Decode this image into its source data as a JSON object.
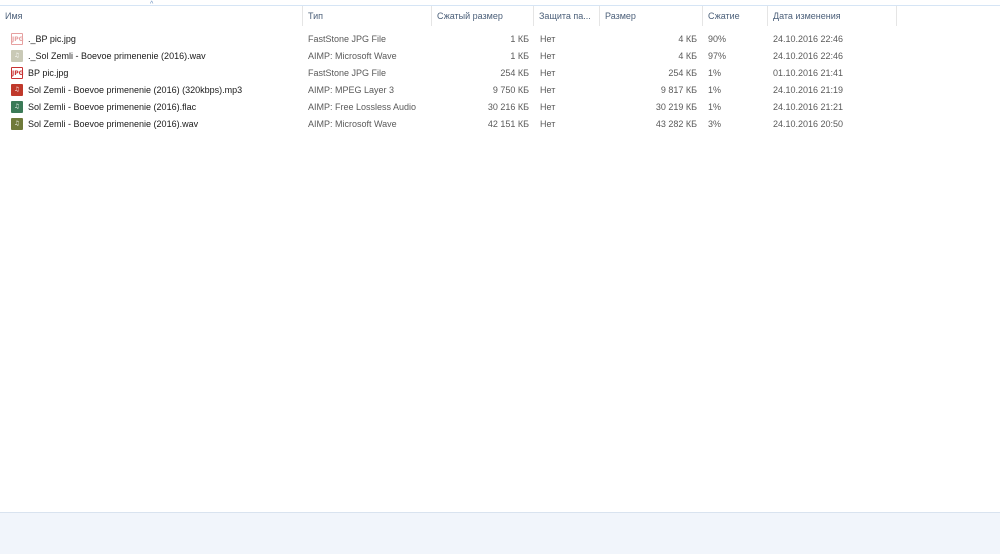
{
  "columns": {
    "name": "Имя",
    "type": "Тип",
    "compressed_size": "Сжатый размер",
    "protection": "Защита па...",
    "size": "Размер",
    "ratio": "Сжатие",
    "modified": "Дата изменения"
  },
  "sort": {
    "column": "name",
    "arrow": "^"
  },
  "files": [
    {
      "icon": "jpg-file-icon",
      "name": "._BP pic.jpg",
      "type": "FastStone JPG File",
      "compressed_size": "1 КБ",
      "protection": "Нет",
      "size": "4 КБ",
      "ratio": "90%",
      "modified": "24.10.2016 22:46"
    },
    {
      "icon": "wav-file-icon",
      "name": "._Sol Zemli - Boevoe primenenie (2016).wav",
      "type": "AIMP: Microsoft Wave",
      "compressed_size": "1 КБ",
      "protection": "Нет",
      "size": "4 КБ",
      "ratio": "97%",
      "modified": "24.10.2016 22:46"
    },
    {
      "icon": "jpg-file-icon",
      "name": "BP pic.jpg",
      "type": "FastStone JPG File",
      "compressed_size": "254 КБ",
      "protection": "Нет",
      "size": "254 КБ",
      "ratio": "1%",
      "modified": "01.10.2016 21:41"
    },
    {
      "icon": "mp3-file-icon",
      "name": "Sol Zemli - Boevoe primenenie (2016) (320kbps).mp3",
      "type": "AIMP: MPEG Layer 3",
      "compressed_size": "9 750 КБ",
      "protection": "Нет",
      "size": "9 817 КБ",
      "ratio": "1%",
      "modified": "24.10.2016 21:19"
    },
    {
      "icon": "flac-file-icon",
      "name": "Sol Zemli - Boevoe primenenie (2016).flac",
      "type": "AIMP: Free Lossless Audio",
      "compressed_size": "30 216 КБ",
      "protection": "Нет",
      "size": "30 219 КБ",
      "ratio": "1%",
      "modified": "24.10.2016 21:21"
    },
    {
      "icon": "wav-file-icon",
      "name": "Sol Zemli - Boevoe primenenie (2016).wav",
      "type": "AIMP: Microsoft Wave",
      "compressed_size": "42 151 КБ",
      "protection": "Нет",
      "size": "43 282 КБ",
      "ratio": "3%",
      "modified": "24.10.2016 20:50"
    }
  ]
}
